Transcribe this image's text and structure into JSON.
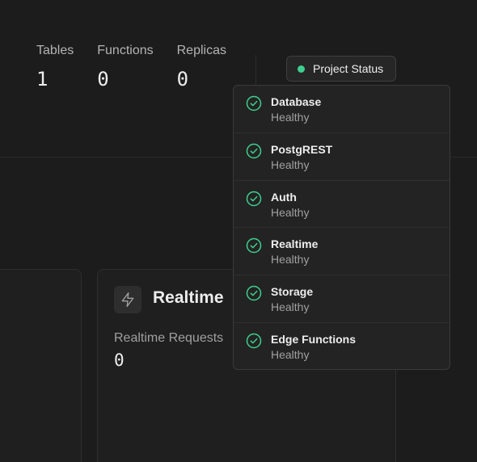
{
  "stats": [
    {
      "label": "Tables",
      "value": "1"
    },
    {
      "label": "Functions",
      "value": "0"
    },
    {
      "label": "Replicas",
      "value": "0"
    }
  ],
  "project_status": {
    "label": "Project Status",
    "dot_color": "#3ecf8e",
    "dot_icon": "status-dot-icon"
  },
  "services": [
    {
      "name": "Database",
      "status": "Healthy",
      "icon": "check-circle-icon"
    },
    {
      "name": "PostgREST",
      "status": "Healthy",
      "icon": "check-circle-icon"
    },
    {
      "name": "Auth",
      "status": "Healthy",
      "icon": "check-circle-icon"
    },
    {
      "name": "Realtime",
      "status": "Healthy",
      "icon": "check-circle-icon"
    },
    {
      "name": "Storage",
      "status": "Healthy",
      "icon": "check-circle-icon"
    },
    {
      "name": "Edge Functions",
      "status": "Healthy",
      "icon": "check-circle-icon"
    }
  ],
  "realtime_card": {
    "title": "Realtime",
    "icon": "lightning-icon",
    "metric_label": "Realtime Requests",
    "metric_value": "0"
  },
  "colors": {
    "accent": "#3ecf8e",
    "background": "#1c1c1c"
  }
}
